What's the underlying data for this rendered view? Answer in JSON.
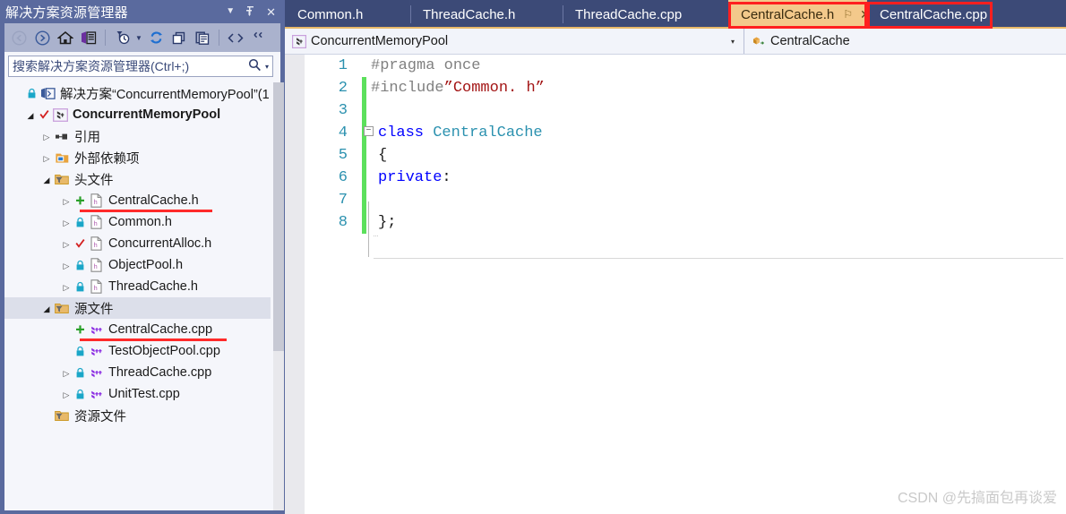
{
  "solution_explorer": {
    "title": "解决方案资源管理器",
    "title_buttons": [
      {
        "name": "dropdown-caret",
        "glyph": "▼"
      },
      {
        "name": "pin-icon",
        "glyph": "⚐"
      },
      {
        "name": "close-icon",
        "glyph": "✕"
      }
    ],
    "toolbar": [
      {
        "name": "back-button",
        "icon": "back-arrow-icon"
      },
      {
        "name": "forward-button",
        "icon": "forward-arrow-icon"
      },
      {
        "name": "home-button",
        "icon": "home-icon"
      },
      {
        "name": "solution-view-button",
        "icon": "solution-view-icon"
      },
      {
        "name": "pending-changes-filter-button",
        "icon": "filter-clock-icon"
      },
      {
        "name": "refresh-button",
        "icon": "refresh-icon"
      },
      {
        "name": "collapse-all-button",
        "icon": "collapse-all-icon"
      },
      {
        "name": "properties-button",
        "icon": "properties-icon"
      },
      {
        "name": "show-all-files-button",
        "icon": "code-brackets-icon"
      },
      {
        "name": "overflow-button",
        "icon": "chevron-double-icon"
      }
    ],
    "search": {
      "placeholder": "搜索解决方案资源管理器(Ctrl+;)",
      "value": "",
      "icon": "search-icon",
      "caret": "▾"
    },
    "tree": [
      {
        "label": "解决方案“ConcurrentMemoryPool”(1",
        "depth": 0,
        "twisty": "",
        "icon": "solution-icon",
        "badge": "lock",
        "bold": false,
        "selected": false,
        "underline": false
      },
      {
        "label": "ConcurrentMemoryPool",
        "depth": 1,
        "twisty": "open",
        "icon": "cpp-project-icon",
        "badge": "check",
        "bold": true,
        "selected": false,
        "underline": false
      },
      {
        "label": "引用",
        "depth": 2,
        "twisty": "closed",
        "icon": "references-icon",
        "badge": "",
        "bold": false,
        "selected": false,
        "underline": false
      },
      {
        "label": "外部依赖项",
        "depth": 2,
        "twisty": "closed",
        "icon": "external-deps-icon",
        "badge": "",
        "bold": false,
        "selected": false,
        "underline": false
      },
      {
        "label": "头文件",
        "depth": 2,
        "twisty": "open",
        "icon": "filter-folder-icon",
        "badge": "",
        "bold": false,
        "selected": false,
        "underline": false
      },
      {
        "label": "CentralCache.h",
        "depth": 3,
        "twisty": "closed",
        "icon": "header-file-icon",
        "badge": "plus",
        "bold": false,
        "selected": false,
        "underline": true
      },
      {
        "label": "Common.h",
        "depth": 3,
        "twisty": "closed",
        "icon": "header-file-icon",
        "badge": "lock",
        "bold": false,
        "selected": false,
        "underline": false
      },
      {
        "label": "ConcurrentAlloc.h",
        "depth": 3,
        "twisty": "closed",
        "icon": "header-file-icon",
        "badge": "check",
        "bold": false,
        "selected": false,
        "underline": false
      },
      {
        "label": "ObjectPool.h",
        "depth": 3,
        "twisty": "closed",
        "icon": "header-file-icon",
        "badge": "lock",
        "bold": false,
        "selected": false,
        "underline": false
      },
      {
        "label": "ThreadCache.h",
        "depth": 3,
        "twisty": "closed",
        "icon": "header-file-icon",
        "badge": "lock",
        "bold": false,
        "selected": false,
        "underline": false
      },
      {
        "label": "源文件",
        "depth": 2,
        "twisty": "open",
        "icon": "filter-folder-icon",
        "badge": "",
        "bold": false,
        "selected": true,
        "underline": false
      },
      {
        "label": "CentralCache.cpp",
        "depth": 3,
        "twisty": "",
        "icon": "cpp-file-icon",
        "badge": "plus",
        "bold": false,
        "selected": false,
        "underline": true
      },
      {
        "label": "TestObjectPool.cpp",
        "depth": 3,
        "twisty": "",
        "icon": "cpp-file-icon",
        "badge": "lock",
        "bold": false,
        "selected": false,
        "underline": false
      },
      {
        "label": "ThreadCache.cpp",
        "depth": 3,
        "twisty": "closed",
        "icon": "cpp-file-icon",
        "badge": "lock",
        "bold": false,
        "selected": false,
        "underline": false
      },
      {
        "label": "UnitTest.cpp",
        "depth": 3,
        "twisty": "closed",
        "icon": "cpp-file-icon",
        "badge": "lock",
        "bold": false,
        "selected": false,
        "underline": false
      },
      {
        "label": "资源文件",
        "depth": 2,
        "twisty": "",
        "icon": "filter-folder-icon",
        "badge": "",
        "bold": false,
        "selected": false,
        "underline": false
      }
    ]
  },
  "editor": {
    "tabs": [
      {
        "label": "Common.h",
        "active": false,
        "highlighted": false
      },
      {
        "label": "ThreadCache.h",
        "active": false,
        "highlighted": false
      },
      {
        "label": "ThreadCache.cpp",
        "active": false,
        "highlighted": false
      },
      {
        "label": "CentralCache.h",
        "active": true,
        "highlighted": true,
        "pin": "⚐",
        "close": "✕"
      },
      {
        "label": "CentralCache.cpp",
        "active": false,
        "highlighted": true
      }
    ],
    "navbar": {
      "project": "ConcurrentMemoryPool",
      "project_icon": "cpp-project-icon",
      "member": "CentralCache",
      "member_icon": "class-icon",
      "caret": "▾"
    },
    "code_lines": [
      {
        "num": "1",
        "changed": false,
        "fold": "",
        "tokens": [
          {
            "t": "#pragma once",
            "c": "tok-pre"
          }
        ]
      },
      {
        "num": "2",
        "changed": true,
        "fold": "",
        "tokens": [
          {
            "t": "#include",
            "c": "tok-pre"
          },
          {
            "t": "”Common. h”",
            "c": "tok-str"
          }
        ]
      },
      {
        "num": "3",
        "changed": true,
        "fold": "",
        "tokens": []
      },
      {
        "num": "4",
        "changed": true,
        "fold": "minus",
        "tokens": [
          {
            "t": "class ",
            "c": "tok-kw"
          },
          {
            "t": "CentralCache",
            "c": "tok-type"
          }
        ]
      },
      {
        "num": "5",
        "changed": true,
        "fold": "",
        "tokens": [
          {
            "t": "{",
            "c": ""
          }
        ]
      },
      {
        "num": "6",
        "changed": true,
        "fold": "",
        "tokens": [
          {
            "t": "private",
            "c": "tok-kw"
          },
          {
            "t": ":",
            "c": ""
          }
        ]
      },
      {
        "num": "7",
        "changed": true,
        "fold": "",
        "tokens": []
      },
      {
        "num": "8",
        "changed": true,
        "fold": "",
        "tokens": [
          {
            "t": "};",
            "c": ""
          }
        ]
      }
    ]
  },
  "watermark": "CSDN @先搞面包再谈爱",
  "colors": {
    "panel_blue": "#5a6a9e",
    "tabstrip_blue": "#3c4a77",
    "active_tab": "#f3c98b",
    "highlight_red": "#ff1f1f",
    "change_bar_green": "#5ce05c",
    "line_number": "#2b91af",
    "keyword_blue": "#0000ff",
    "string_red": "#a31515",
    "preproc_gray": "#808080"
  }
}
